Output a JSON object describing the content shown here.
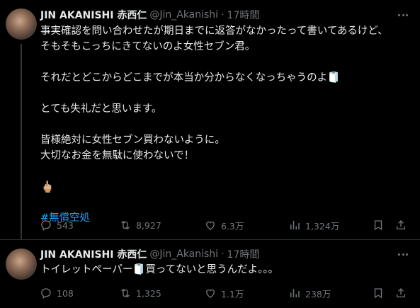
{
  "tweets": [
    {
      "author_name": "JIN AKANISHI 赤西仁",
      "handle": "@Jin_Akanishi",
      "separator": "·",
      "time": "17時間",
      "lines": [
        "事実確認を問い合わせたが期日までに返答がなかったって書いてあるけど、",
        "そもそもこっちにきてないのよ女性セブン君。",
        "",
        "それだとどこからどこまでが本当か分からなくなっちゃうのよ🧻",
        "",
        "とても失礼だと思います。",
        "",
        "皆様絶対に女性セブン買わないように。",
        "大切なお金を無駄に使わないで！",
        "",
        "🖕🏼",
        "",
        "#無償空処"
      ],
      "hashtag": "#無償空処",
      "stats": {
        "replies": "543",
        "retweets": "8,927",
        "likes": "6.3万",
        "views": "1,324万"
      }
    },
    {
      "author_name": "JIN AKANISHI 赤西仁",
      "handle": "@Jin_Akanishi",
      "separator": "·",
      "time": "17時間",
      "text": "トイレットペーパー🧻買ってないと思うんだよ。。。",
      "stats": {
        "replies": "108",
        "retweets": "1,325",
        "likes": "1.1万",
        "views": "238万"
      }
    }
  ],
  "icons": {
    "reply": "reply-icon",
    "retweet": "retweet-icon",
    "like": "heart-icon",
    "views": "views-icon",
    "bookmark": "bookmark-icon",
    "share": "share-icon",
    "more": "more-icon"
  },
  "colors": {
    "background": "#000000",
    "text": "#e7e9ea",
    "muted": "#71767b",
    "link": "#1d9bf0",
    "border": "#2f3336"
  }
}
